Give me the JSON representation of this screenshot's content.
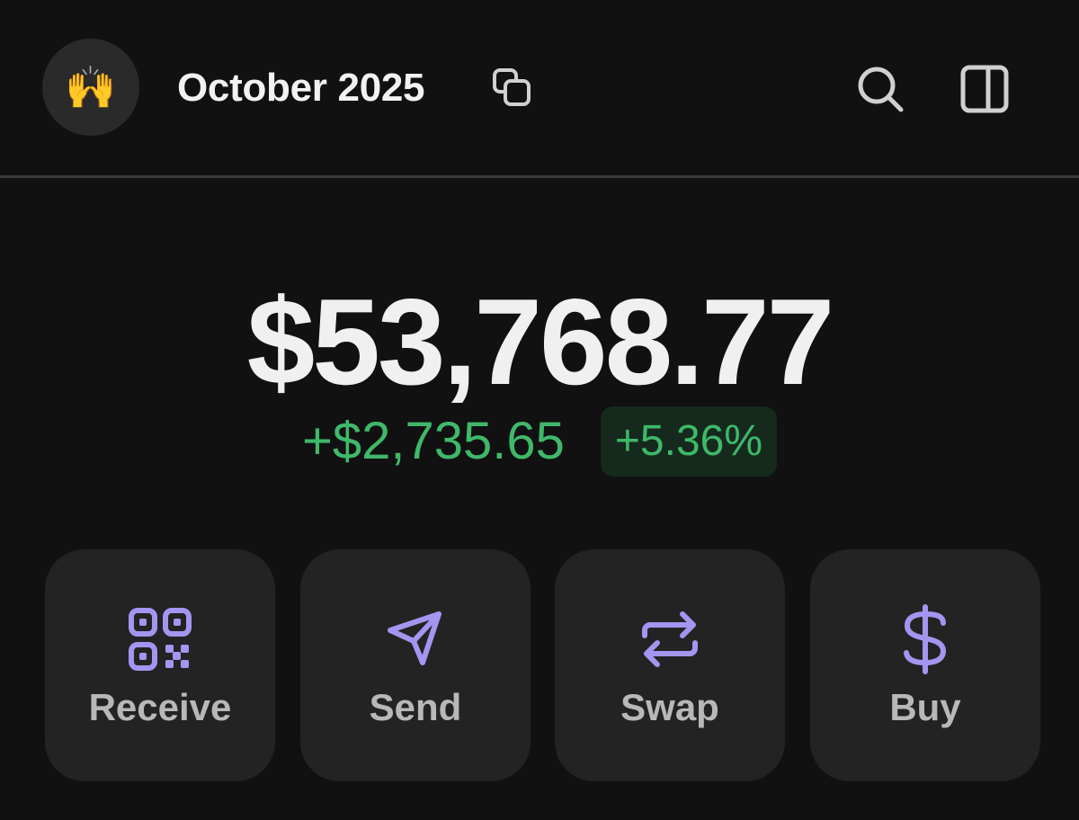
{
  "header": {
    "avatar_emoji": "🙌",
    "account_name": "October 2025",
    "icons": {
      "copy": "copy-icon",
      "search": "search-icon",
      "panel": "sidebar-panel-icon"
    }
  },
  "balance": {
    "total": "$53,768.77",
    "change_amount": "+$2,735.65",
    "change_percent": "+5.36%"
  },
  "actions": [
    {
      "label": "Receive",
      "icon": "qr-code-icon"
    },
    {
      "label": "Send",
      "icon": "send-icon"
    },
    {
      "label": "Swap",
      "icon": "swap-icon"
    },
    {
      "label": "Buy",
      "icon": "dollar-icon"
    }
  ],
  "colors": {
    "background": "#111111",
    "positive": "#3fb86a",
    "accent": "#a594f0",
    "card": "#232323"
  }
}
